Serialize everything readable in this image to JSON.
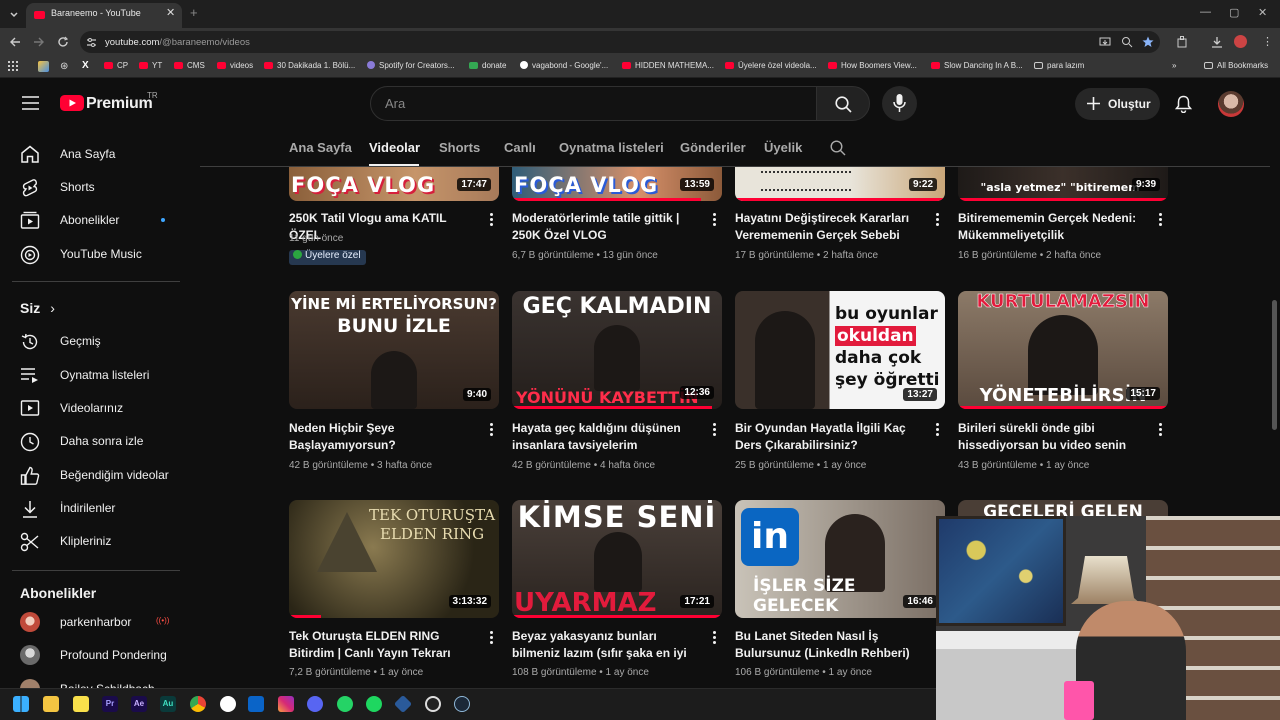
{
  "browser": {
    "tab_title": "Baraneemo - YouTube",
    "url_host": "youtube.com",
    "url_path": "/@baraneemo/videos",
    "bookmarks": [
      "CP",
      "YT",
      "CMS",
      "videos",
      "30 Dakikada 1. Bölü...",
      "Spotify for Creators...",
      "donate",
      "vagabond - Google'...",
      "HIDDEN MATHEMA...",
      "Üyelere özel videola...",
      "How Boomers View...",
      "Slow Dancing In A B...",
      "para lazım"
    ],
    "all_bookmarks": "All Bookmarks"
  },
  "header": {
    "logo_text": "Premium",
    "region": "TR",
    "search_placeholder": "Ara",
    "create_label": "Oluştur"
  },
  "sidebar": {
    "main": [
      {
        "label": "Ana Sayfa",
        "icon": "home-icon"
      },
      {
        "label": "Shorts",
        "icon": "shorts-icon"
      },
      {
        "label": "Abonelikler",
        "icon": "subscriptions-icon"
      },
      {
        "label": "YouTube Music",
        "icon": "music-icon"
      }
    ],
    "you_heading": "Siz",
    "you": [
      {
        "label": "Geçmiş",
        "icon": "history-icon"
      },
      {
        "label": "Oynatma listeleri",
        "icon": "playlists-icon"
      },
      {
        "label": "Videolarınız",
        "icon": "your-videos-icon"
      },
      {
        "label": "Daha sonra izle",
        "icon": "watch-later-icon"
      },
      {
        "label": "Beğendiğim videolar",
        "icon": "liked-icon"
      },
      {
        "label": "İndirilenler",
        "icon": "downloads-icon"
      },
      {
        "label": "Klipleriniz",
        "icon": "clips-icon"
      }
    ],
    "subs_heading": "Abonelikler",
    "subs": [
      {
        "label": "parkenharbor",
        "color": "#c04a3a"
      },
      {
        "label": "Profound Pondering",
        "color": "#7a7a7a"
      },
      {
        "label": "Bailey Schildbach",
        "color": "#a0806a"
      }
    ]
  },
  "channel_tabs": [
    "Ana Sayfa",
    "Videolar",
    "Shorts",
    "Canlı",
    "Oynatma listeleri",
    "Gönderiler",
    "Üyelik"
  ],
  "active_tab": "Videolar",
  "videos": [
    {
      "title": "250K Tatil Vlogu ama KATIL ÖZEL",
      "meta": "11 gün önce",
      "duration": "17:47",
      "badge": "Üyelere özel",
      "thumb_text": "FOÇA VLOG",
      "progress": 0
    },
    {
      "title": "Moderatörlerimle tatile gittik | 250K Özel VLOG",
      "meta": "6,7 B görüntüleme • 13 gün önce",
      "duration": "13:59",
      "thumb_text": "FOÇA VLOG",
      "progress": 0.9
    },
    {
      "title": "Hayatını Değiştirecek Kararları Verememenin Gerçek Sebebi (anal...",
      "meta": "17 B görüntüleme • 2 hafta önce",
      "duration": "9:22",
      "thumb_text": "",
      "progress": 1
    },
    {
      "title": "Bitiremememin Gerçek Nedeni: Mükemmeliyetçilik",
      "meta": "16 B görüntüleme • 2 hafta önce",
      "duration": "9:39",
      "thumb_text": "\"asla yetmez\"   \"bitiremem\"",
      "progress": 1
    },
    {
      "title": "Neden Hiçbir Şeye Başlayamıyorsun?",
      "meta": "42 B görüntüleme • 3 hafta önce",
      "duration": "9:40",
      "thumb_text": "YİNE Mİ ERTELİYORSUN? BUNU İZLE",
      "progress": 0
    },
    {
      "title": "Hayata geç kaldığını düşünen insanlara tavsiyelerim",
      "meta": "42 B görüntüleme • 4 hafta önce",
      "duration": "12:36",
      "thumb_text": "GEÇ KALMADIN / YÖNÜNÜ KAYBETTİN",
      "progress": 0.95
    },
    {
      "title": "Bir Oyundan Hayatla İlgili Kaç Ders Çıkarabilirsiniz?",
      "meta": "25 B görüntüleme • 1 ay önce",
      "duration": "13:27",
      "thumb_text": "bu oyunlar okuldan daha çok şey öğretti",
      "progress": 0
    },
    {
      "title": "Birileri sürekli önde gibi hissediyorsan bu video senin için...",
      "meta": "43 B görüntüleme • 1 ay önce",
      "duration": "15:17",
      "thumb_text": "KURTULAMAZSIN / YÖNETEBİLİRSİN",
      "progress": 1
    },
    {
      "title": "Tek Oturuşta ELDEN RING Bitirdim | Canlı Yayın Tekrarı (bitirmez...",
      "meta": "7,2 B görüntüleme • 1 ay önce",
      "duration": "3:13:32",
      "thumb_text": "TEK OTURUŞTA ELDEN RING",
      "progress": 0.15
    },
    {
      "title": "Beyaz yakasyanız bunları bilmeniz lazım (sıfır şaka en iyi tavsiye...",
      "meta": "108 B görüntüleme • 1 ay önce",
      "duration": "17:21",
      "thumb_text": "KİMSE SENİ UYARMAZ",
      "progress": 1
    },
    {
      "title": "Bu Lanet Siteden Nasıl İş Bulursunuz (LinkedIn Rehberi)",
      "meta": "106 B görüntüleme • 1 ay önce",
      "duration": "16:46",
      "thumb_text": "İŞLER SİZE GELECEK",
      "progress": 0
    },
    {
      "title": "",
      "meta": "",
      "duration": "",
      "thumb_text": "GECELERİ GELEN",
      "progress": 0
    }
  ],
  "colors": {
    "accent": "#ff0033",
    "bg": "#0f0f0f",
    "member_badge": "#263850"
  }
}
